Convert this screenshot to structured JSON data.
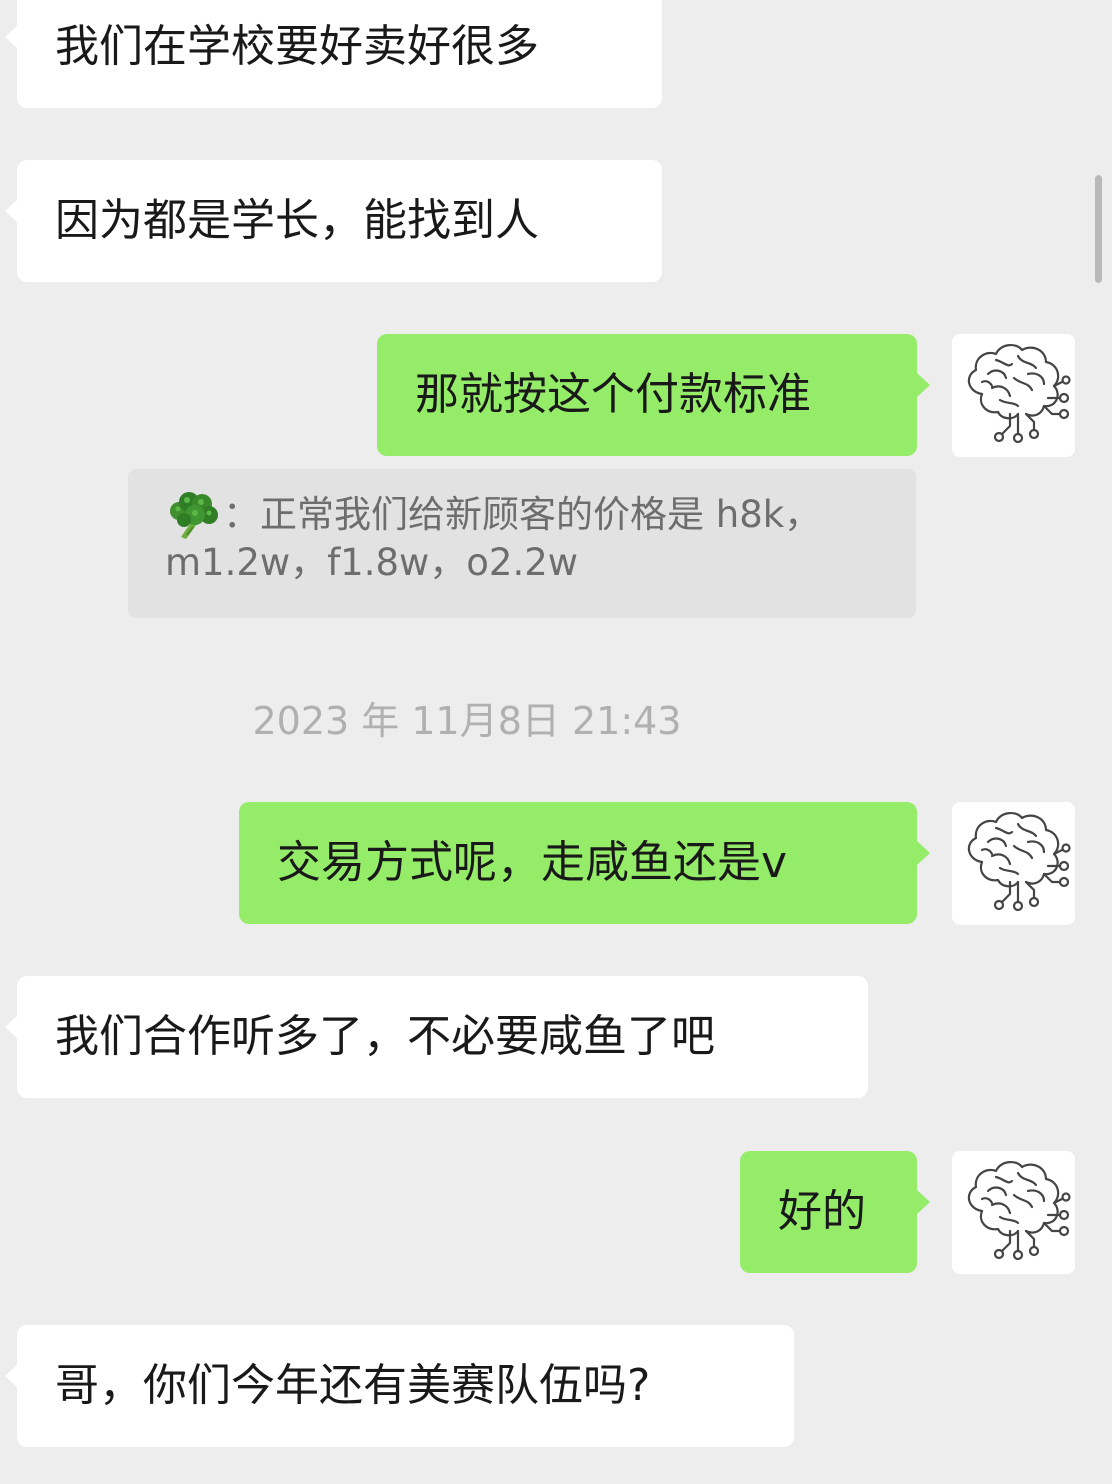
{
  "messages": [
    {
      "side": "in",
      "text": "我们在学校要好卖好很多"
    },
    {
      "side": "in",
      "text": "因为都是学长，能找到人"
    },
    {
      "side": "out",
      "text": "那就按这个付款标准"
    },
    {
      "side": "out",
      "text": "交易方式呢，走咸鱼还是v"
    },
    {
      "side": "in",
      "text": "我们合作听多了，不必要咸鱼了吧"
    },
    {
      "side": "out",
      "text": "好的"
    },
    {
      "side": "in",
      "text": "哥，你们今年还有美赛队伍吗?"
    }
  ],
  "quote": {
    "sender_icon": "broccoli-icon",
    "separator": "：",
    "line1": "正常我们给新顾客的价格是 h8k，",
    "line2": "m1.2w，f1.8w，o2.2w"
  },
  "timestamp": "2023 年 11月8日 21:43",
  "avatar_icon": "brain-circuit-icon",
  "colors": {
    "background": "#ededed",
    "incoming_bubble": "#ffffff",
    "outgoing_bubble": "#95ec69",
    "quote_background": "#e2e2e2"
  }
}
